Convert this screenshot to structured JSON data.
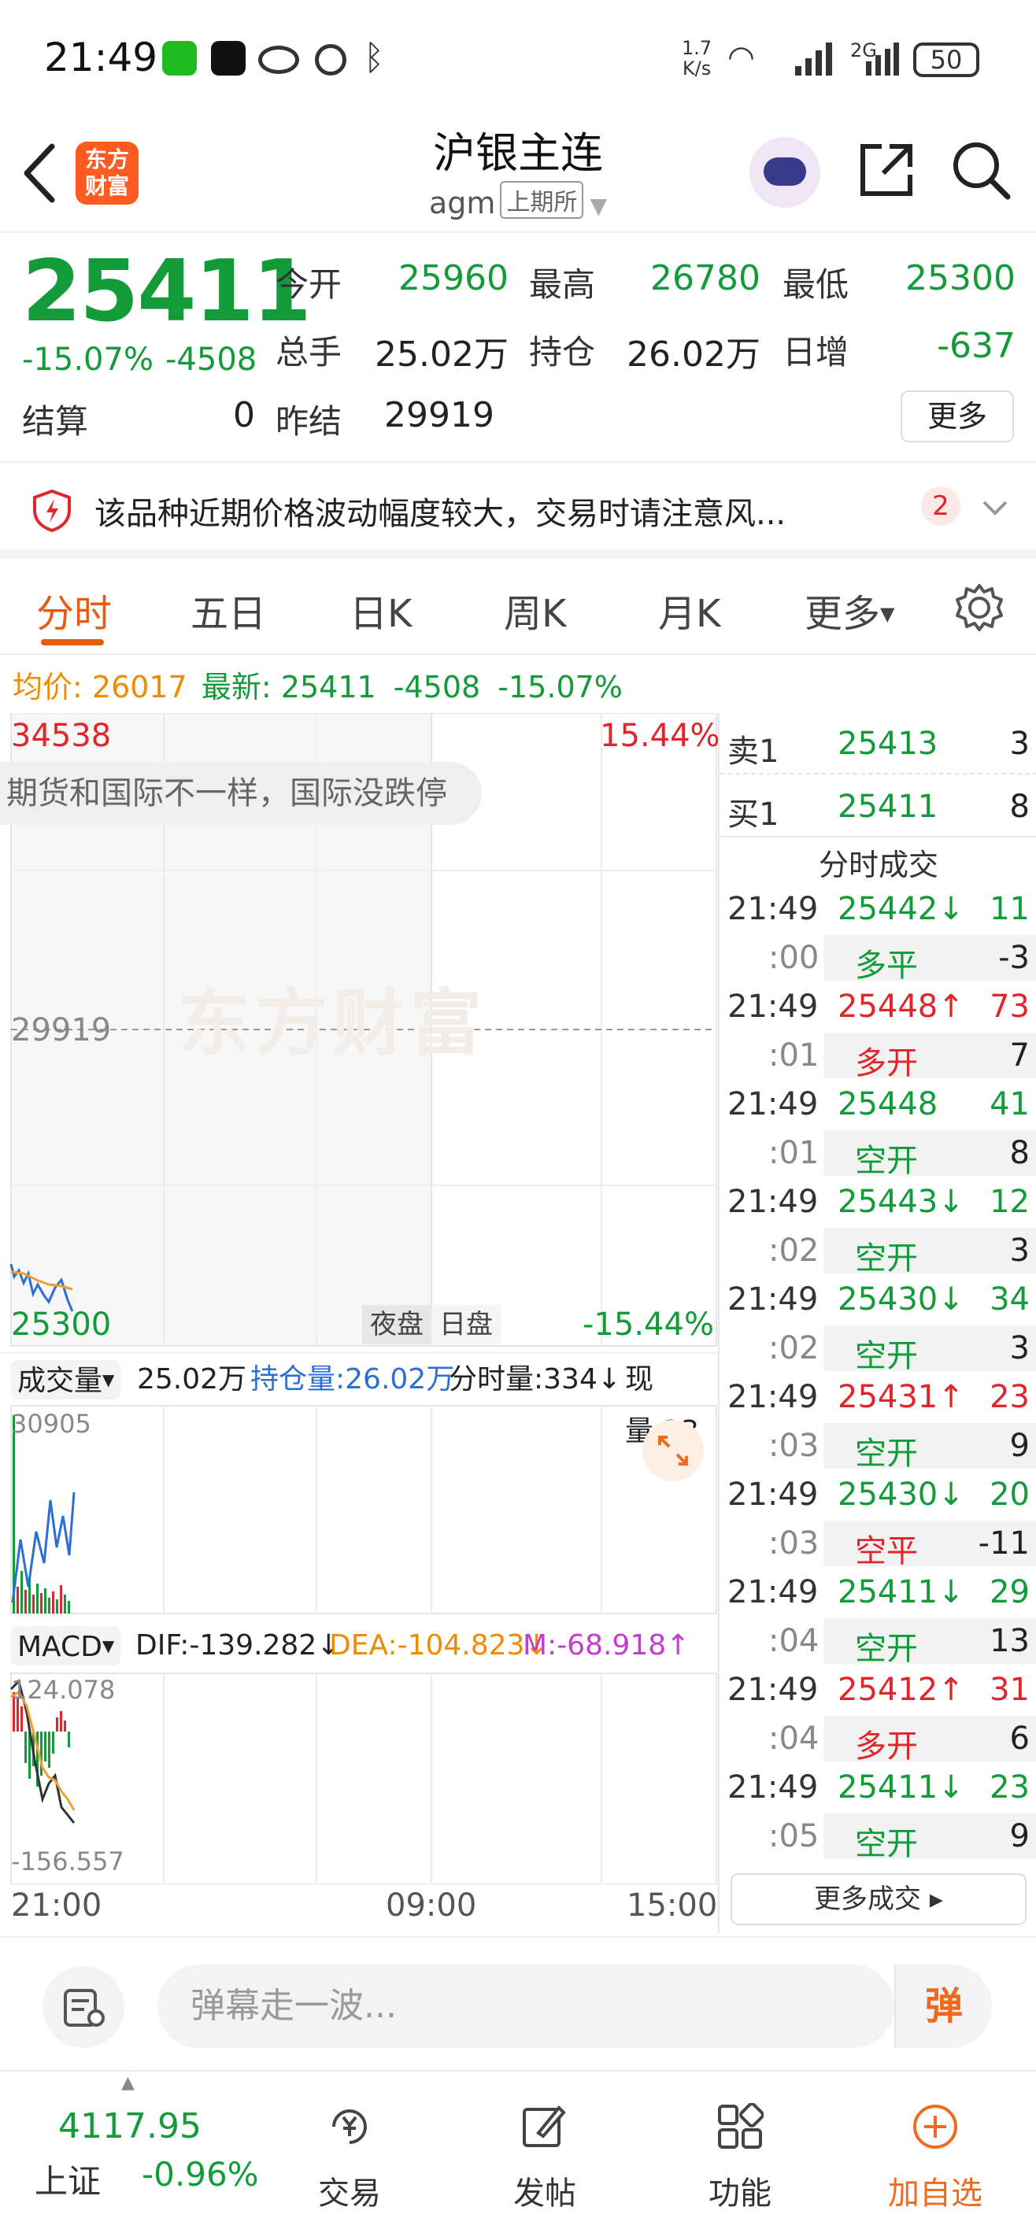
{
  "status_bar": {
    "time": "21:49",
    "net_speed_top": "1.7",
    "net_speed_bottom": "K/s",
    "signal_label": "2G",
    "battery": "50"
  },
  "header": {
    "logo_line1": "东方",
    "logo_line2": "财富",
    "title": "沪银主连",
    "code": "agm",
    "exchange": "上期所"
  },
  "quote": {
    "price": "25411",
    "change_pct": "-15.07%",
    "change_abs": "-4508",
    "open_label": "今开",
    "open": "25960",
    "high_label": "最高",
    "high": "26780",
    "low_label": "最低",
    "low": "25300",
    "volume_label": "总手",
    "volume": "25.02万",
    "oi_label": "持仓",
    "oi": "26.02万",
    "daily_inc_label": "日增",
    "daily_inc": "-637",
    "settle_label": "结算",
    "settle": "0",
    "prev_settle_label": "昨结",
    "prev_settle": "29919",
    "more_label": "更多"
  },
  "notice": {
    "text": "该品种近期价格波动幅度较大，交易时请注意风...",
    "count": "2"
  },
  "tabs": [
    "分时",
    "五日",
    "日K",
    "周K",
    "月K",
    "更多"
  ],
  "avg_line": {
    "avg_label": "均价:",
    "avg": "26017",
    "latest_label": "最新:",
    "latest": "25411",
    "change_abs": "-4508",
    "change_pct": "-15.07%"
  },
  "chart": {
    "top_price": "34538",
    "top_pct": "15.44%",
    "mid_price": "29919",
    "bottom_price": "25300",
    "bottom_pct": "-15.44%",
    "watermark": "东方财富",
    "comment": "期货和国际不一样，国际没跌停",
    "session_night": "夜盘",
    "session_day": "日盘",
    "vol_bar": {
      "selector": "成交量",
      "total": "25.02万",
      "oi": "持仓量:26.02万",
      "tick_vol": "分时量:334↓",
      "cur_vol": "现量:23"
    },
    "vol_max": "30905",
    "macd_bar": {
      "selector": "MACD",
      "dif": "DIF:-139.282↓",
      "dea": "DEA:-104.823↓",
      "m": "M:-68.918↑"
    },
    "macd_max": "124.078",
    "macd_min": "-156.557",
    "time_axis": [
      "21:00",
      "09:00",
      "15:00"
    ]
  },
  "book": {
    "ask_label": "卖1",
    "ask_price": "25413",
    "ask_vol": "3",
    "bid_label": "买1",
    "bid_price": "25411",
    "bid_vol": "8",
    "trades_title": "分时成交",
    "trades": [
      {
        "time": "21:49",
        "price": "25442↓",
        "vol": "11",
        "dir": "down",
        "sub_time": ":00",
        "type": "多平",
        "chg": "-3",
        "type_color": "green"
      },
      {
        "time": "21:49",
        "price": "25448↑",
        "vol": "73",
        "dir": "up",
        "sub_time": ":01",
        "type": "多开",
        "chg": "7",
        "type_color": "red"
      },
      {
        "time": "21:49",
        "price": "25448",
        "vol": "41",
        "dir": "down",
        "sub_time": ":01",
        "type": "空开",
        "chg": "8",
        "type_color": "green"
      },
      {
        "time": "21:49",
        "price": "25443↓",
        "vol": "12",
        "dir": "down",
        "sub_time": ":02",
        "type": "空开",
        "chg": "3",
        "type_color": "green"
      },
      {
        "time": "21:49",
        "price": "25430↓",
        "vol": "34",
        "dir": "down",
        "sub_time": ":02",
        "type": "空开",
        "chg": "3",
        "type_color": "green"
      },
      {
        "time": "21:49",
        "price": "25431↑",
        "vol": "23",
        "dir": "up",
        "sub_time": ":03",
        "type": "空开",
        "chg": "9",
        "type_color": "green"
      },
      {
        "time": "21:49",
        "price": "25430↓",
        "vol": "20",
        "dir": "down",
        "sub_time": ":03",
        "type": "空平",
        "chg": "-11",
        "type_color": "red"
      },
      {
        "time": "21:49",
        "price": "25411↓",
        "vol": "29",
        "dir": "down",
        "sub_time": ":04",
        "type": "空开",
        "chg": "13",
        "type_color": "green"
      },
      {
        "time": "21:49",
        "price": "25412↑",
        "vol": "31",
        "dir": "up",
        "sub_time": ":04",
        "type": "多开",
        "chg": "6",
        "type_color": "red"
      },
      {
        "time": "21:49",
        "price": "25411↓",
        "vol": "23",
        "dir": "down",
        "sub_time": ":05",
        "type": "空开",
        "chg": "9",
        "type_color": "green"
      }
    ],
    "more_trades": "更多成交 ▸"
  },
  "danmaku": {
    "placeholder": "弹幕走一波...",
    "send_label": "弹"
  },
  "bottom_nav": {
    "index_value": "4117.95",
    "index_name": "上证",
    "index_pct": "-0.96%",
    "items": [
      "交易",
      "发帖",
      "功能",
      "加自选"
    ]
  },
  "colors": {
    "down": "#139b3a",
    "up": "#e0262b",
    "accent": "#e65a12"
  }
}
